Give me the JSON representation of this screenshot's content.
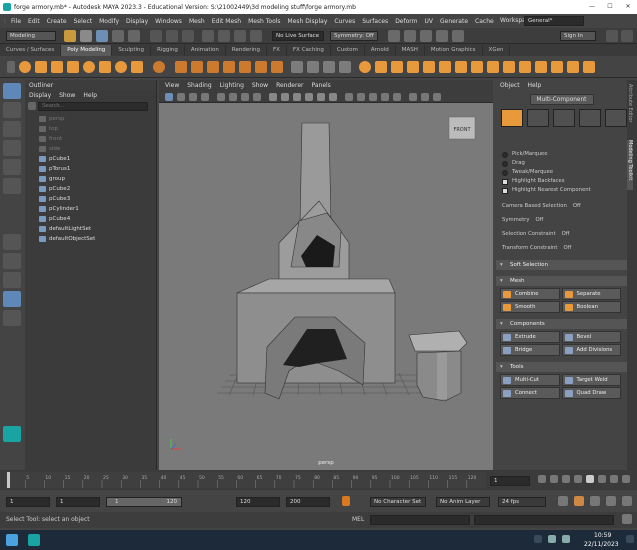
{
  "titlebar": {
    "title": "forge armory.mb* - Autodesk MAYA 2023.3 - Educational Version: S:\\21002449\\3d modeling stuff\\forge armory.mb"
  },
  "menubar": {
    "items": [
      "File",
      "Edit",
      "Create",
      "Select",
      "Modify",
      "Display",
      "Windows",
      "Mesh",
      "Edit Mesh",
      "Mesh Tools",
      "Mesh Display",
      "Curves",
      "Surfaces",
      "Deform",
      "UV",
      "Generate",
      "Cache"
    ],
    "workspace_label": "Workspace:",
    "workspace_value": "General*"
  },
  "statusline": {
    "mode": "Modeling",
    "live_surface": "No Live Surface",
    "symmetry": "Symmetry: Off",
    "signin": "Sign In"
  },
  "shelf_tabs": [
    "Curves / Surfaces",
    "Poly Modeling",
    "Sculpting",
    "Rigging",
    "Animation",
    "Rendering",
    "FX",
    "FX Caching",
    "Custom",
    "Arnold",
    "MASH",
    "Motion Graphics",
    "XGen"
  ],
  "shelf_active": "Poly Modeling",
  "outliner": {
    "title": "Outliner",
    "menu": [
      "Display",
      "Show",
      "Help"
    ],
    "search_placeholder": "Search...",
    "items": [
      {
        "label": "persp",
        "dim": true
      },
      {
        "label": "top",
        "dim": true
      },
      {
        "label": "front",
        "dim": true
      },
      {
        "label": "side",
        "dim": true
      },
      {
        "label": "pCube1",
        "dim": false
      },
      {
        "label": "pTorus1",
        "dim": false
      },
      {
        "label": "group",
        "dim": false
      },
      {
        "label": "pCube2",
        "dim": false
      },
      {
        "label": "pCube3",
        "dim": false
      },
      {
        "label": "pCylinder1",
        "dim": false
      },
      {
        "label": "pCube4",
        "dim": false
      },
      {
        "label": "defaultLightSet",
        "dim": false
      },
      {
        "label": "defaultObjectSet",
        "dim": false
      }
    ]
  },
  "viewport": {
    "menu": [
      "View",
      "Shading",
      "Lighting",
      "Show",
      "Renderer",
      "Panels"
    ],
    "camera_label": "persp",
    "viewcube_label": "FRONT"
  },
  "rightpanel": {
    "menu": [
      "Object",
      "Help"
    ],
    "title": "Multi-Component",
    "options": [
      {
        "label": "Pick/Marquee",
        "checked": false,
        "radio": true
      },
      {
        "label": "Drag",
        "checked": false,
        "radio": true
      },
      {
        "label": "Tweak/Marquee",
        "checked": false,
        "radio": true
      },
      {
        "label": "Highlight Backfaces",
        "checked": true,
        "radio": false
      },
      {
        "label": "Highlight Nearest Component",
        "checked": true,
        "radio": false
      }
    ],
    "settings": [
      {
        "label": "Camera Based Selection",
        "value": "Off"
      },
      {
        "label": "Symmetry",
        "value": "Off"
      },
      {
        "label": "Selection Constraint",
        "value": "Off"
      },
      {
        "label": "Transform Constraint",
        "value": "Off"
      }
    ],
    "soft_selection": "Soft Selection",
    "mesh_section": "Mesh",
    "mesh_buttons": [
      [
        "Combine",
        "Separate"
      ],
      [
        "Smooth",
        "Boolean"
      ]
    ],
    "components_section": "Components",
    "components_buttons": [
      [
        "Extrude",
        "Bevel"
      ],
      [
        "Bridge",
        "Add Divisions"
      ]
    ],
    "tools_section": "Tools",
    "tools_buttons": [
      [
        "Multi-Cut",
        "Target Weld"
      ],
      [
        "Connect",
        "Quad Draw"
      ]
    ],
    "side_tabs": [
      "Attribute Editor",
      "Modeling Toolkit"
    ]
  },
  "timeline": {
    "ticks": [
      "5",
      "10",
      "15",
      "20",
      "25",
      "30",
      "35",
      "40",
      "45",
      "50",
      "55",
      "60",
      "65",
      "70",
      "75",
      "80",
      "85",
      "90",
      "95",
      "100",
      "105",
      "110",
      "115",
      "120"
    ],
    "current": "1"
  },
  "range": {
    "start": "1",
    "start2": "1",
    "slider_start": "1",
    "slider_end": "120",
    "end": "120",
    "end2": "200",
    "character_set": "No Character Set",
    "anim_layer": "No Anim Layer",
    "fps": "24 fps"
  },
  "cmdline": {
    "help": "Select Tool: select an object",
    "lang": "MEL"
  },
  "taskbar": {
    "time": "10:59",
    "date": "22/11/2023"
  }
}
